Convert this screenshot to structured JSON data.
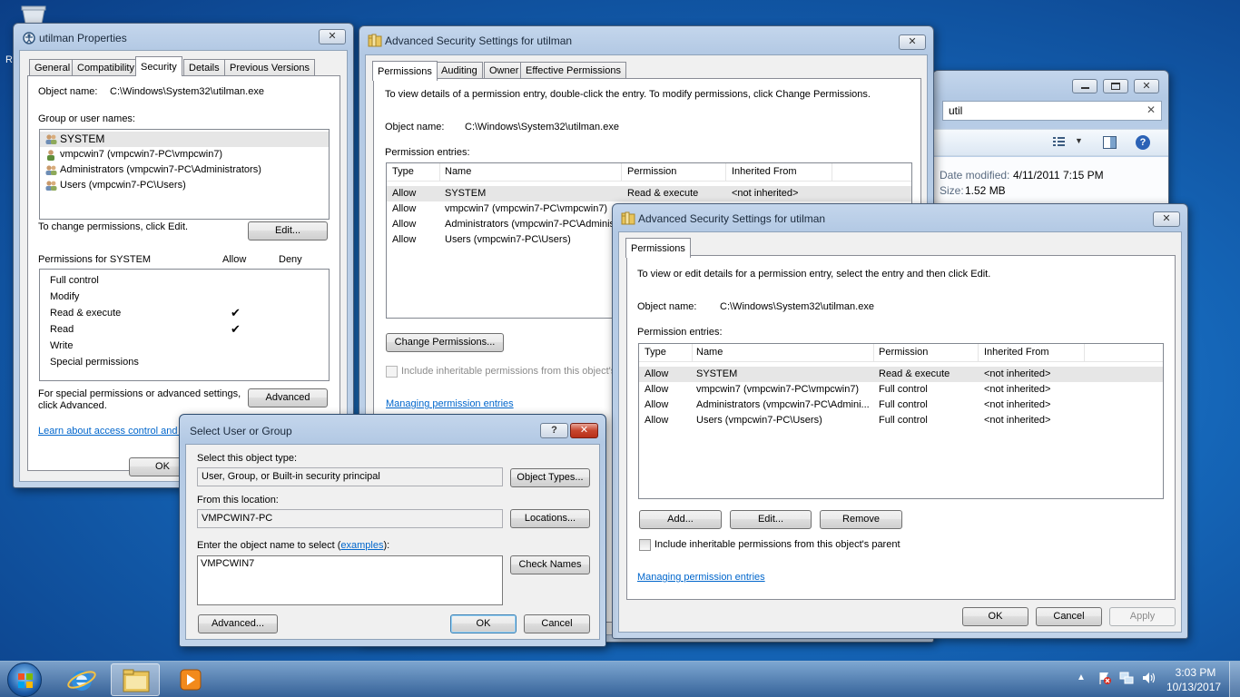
{
  "desktop": {
    "recycle_label": "R"
  },
  "props": {
    "title": "utilman Properties",
    "tabs": [
      "General",
      "Compatibility",
      "Security",
      "Details",
      "Previous Versions"
    ],
    "object_name_label": "Object name:",
    "object_name_value": "C:\\Windows\\System32\\utilman.exe",
    "group_label": "Group or user names:",
    "users": [
      "SYSTEM",
      "vmpcwin7 (vmpcwin7-PC\\vmpcwin7)",
      "Administrators (vmpcwin7-PC\\Administrators)",
      "Users (vmpcwin7-PC\\Users)"
    ],
    "change_text": "To change permissions, click Edit.",
    "edit_button": "Edit...",
    "perm_for": "Permissions for SYSTEM",
    "allow_col": "Allow",
    "deny_col": "Deny",
    "perms": [
      "Full control",
      "Modify",
      "Read & execute",
      "Read",
      "Write",
      "Special permissions"
    ],
    "check_mark": "✔",
    "special_text_1": "For special permissions or advanced settings,",
    "special_text_2": "click Advanced.",
    "advanced_button": "Advanced",
    "learn_link": "Learn about access control and p",
    "ok_button": "OK"
  },
  "adv1": {
    "title": "Advanced Security Settings for utilman",
    "tabs": [
      "Permissions",
      "Auditing",
      "Owner",
      "Effective Permissions"
    ],
    "intro": "To view details of a permission entry, double-click the entry. To modify permissions, click Change Permissions.",
    "object_name_label": "Object name:",
    "object_name_value": "C:\\Windows\\System32\\utilman.exe",
    "entries_label": "Permission entries:",
    "columns": [
      "Type",
      "Name",
      "Permission",
      "Inherited From"
    ],
    "rows": [
      [
        "Allow",
        "SYSTEM",
        "Read & execute",
        "<not inherited>"
      ],
      [
        "Allow",
        "vmpcwin7 (vmpcwin7-PC\\vmpcwin7)",
        "",
        ""
      ],
      [
        "Allow",
        "Administrators (vmpcwin7-PC\\Administ...",
        "",
        ""
      ],
      [
        "Allow",
        "Users (vmpcwin7-PC\\Users)",
        "",
        ""
      ]
    ],
    "change_button": "Change Permissions...",
    "include_text": "Include inheritable permissions from this object's pa",
    "manage_link": "Managing permission entries"
  },
  "explorer": {
    "search_value": "util",
    "date_modified_label": "Date modified:",
    "date_modified_value": "4/11/2011 7:15 PM",
    "size_label": "Size:",
    "size_value": "1.52 MB"
  },
  "adv2": {
    "title": "Advanced Security Settings for utilman",
    "tab": "Permissions",
    "intro": "To view or edit details for a permission entry, select the entry and then click Edit.",
    "object_name_label": "Object name:",
    "object_name_value": "C:\\Windows\\System32\\utilman.exe",
    "entries_label": "Permission entries:",
    "columns": [
      "Type",
      "Name",
      "Permission",
      "Inherited From"
    ],
    "rows": [
      [
        "Allow",
        "SYSTEM",
        "Read & execute",
        "<not inherited>"
      ],
      [
        "Allow",
        "vmpcwin7 (vmpcwin7-PC\\vmpcwin7)",
        "Full control",
        "<not inherited>"
      ],
      [
        "Allow",
        "Administrators (vmpcwin7-PC\\Admini...",
        "Full control",
        "<not inherited>"
      ],
      [
        "Allow",
        "Users (vmpcwin7-PC\\Users)",
        "Full control",
        "<not inherited>"
      ]
    ],
    "add_button": "Add...",
    "edit_button": "Edit...",
    "remove_button": "Remove",
    "include_text": "Include inheritable permissions from this object's parent",
    "manage_link": "Managing permission entries",
    "ok_button": "OK",
    "cancel_button": "Cancel",
    "apply_button": "Apply"
  },
  "select": {
    "title": "Select User or Group",
    "help_button": "?",
    "object_type_label": "Select this object type:",
    "object_type_value": "User, Group, or Built-in security principal",
    "object_types_button": "Object Types...",
    "location_label": "From this location:",
    "location_value": "VMPCWIN7-PC",
    "locations_button": "Locations...",
    "enter_label": "Enter the object name to select (",
    "examples_link": "examples",
    "enter_label_end": "):",
    "enter_value": "VMPCWIN7",
    "check_names_button": "Check Names",
    "advanced_button": "Advanced...",
    "ok_button": "OK",
    "cancel_button": "Cancel"
  },
  "taskbar": {
    "time": "3:03 PM",
    "date": "10/13/2017"
  }
}
